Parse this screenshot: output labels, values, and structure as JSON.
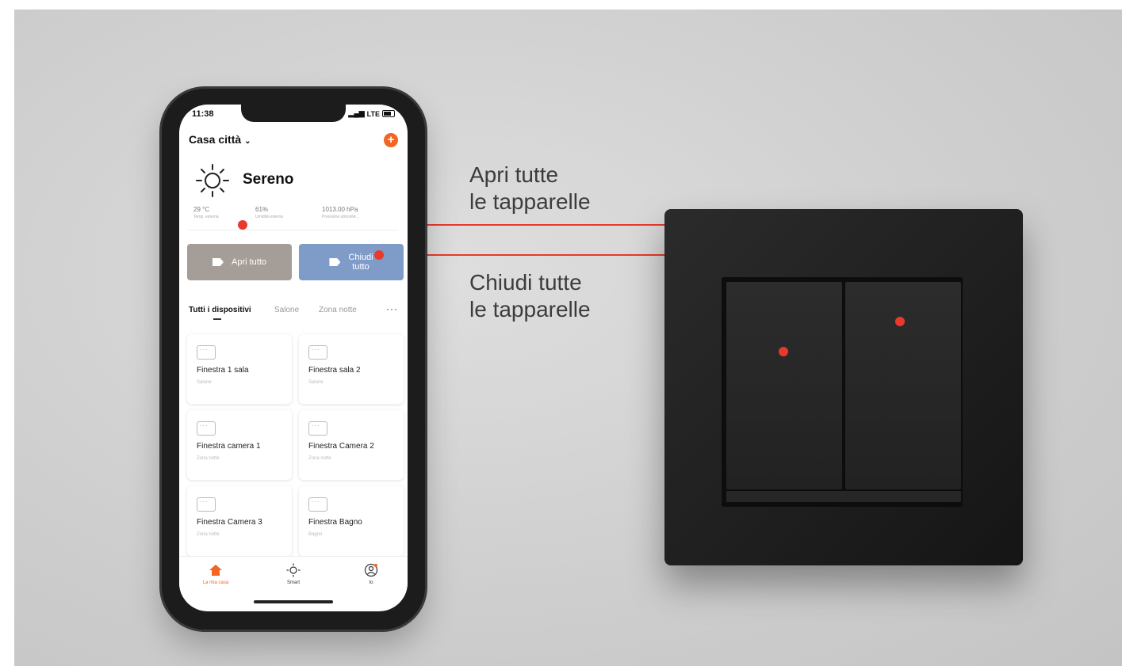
{
  "colors": {
    "accent": "#f26522",
    "open_button": "#a59d98",
    "close_button": "#7f9cc9",
    "annotation": "#e8392c"
  },
  "status_bar": {
    "time": "11:38",
    "network": "LTE"
  },
  "header": {
    "home_name": "Casa città",
    "add_icon": "plus-icon"
  },
  "weather": {
    "icon": "sun-icon",
    "condition": "Sereno",
    "stats": [
      {
        "value": "29 °C",
        "label": "Temp. esterna"
      },
      {
        "value": "61%",
        "label": "Umidità esterna"
      },
      {
        "value": "1013.00 hPa",
        "label": "Pressione atmosfer..."
      }
    ]
  },
  "scenes": [
    {
      "label": "Apri tutto",
      "icon": "tag-icon"
    },
    {
      "label": "Chiudi\ntutto",
      "icon": "tag-icon"
    }
  ],
  "tabs": {
    "items": [
      "Tutti i dispositivi",
      "Salone",
      "Zona notte"
    ],
    "active": 0,
    "more": "···"
  },
  "devices": [
    {
      "name": "Finestra 1 sala",
      "room": "Salone"
    },
    {
      "name": "Finestra sala 2",
      "room": "Salone"
    },
    {
      "name": "Finestra camera 1",
      "room": "Zona notte"
    },
    {
      "name": "Finestra Camera 2",
      "room": "Zona notte"
    },
    {
      "name": "Finestra Camera 3",
      "room": "Zona notte"
    },
    {
      "name": "Finestra Bagno",
      "room": "Bagno"
    }
  ],
  "bottom_nav": [
    {
      "label": "La mia casa",
      "icon": "home-icon",
      "active": true
    },
    {
      "label": "Smart",
      "icon": "sun-outline-icon",
      "active": false
    },
    {
      "label": "Io",
      "icon": "profile-icon",
      "active": false
    }
  ],
  "captions": {
    "open": "Apri tutte\nle tapparelle",
    "close": "Chiudi tutte\nle tapparelle"
  }
}
